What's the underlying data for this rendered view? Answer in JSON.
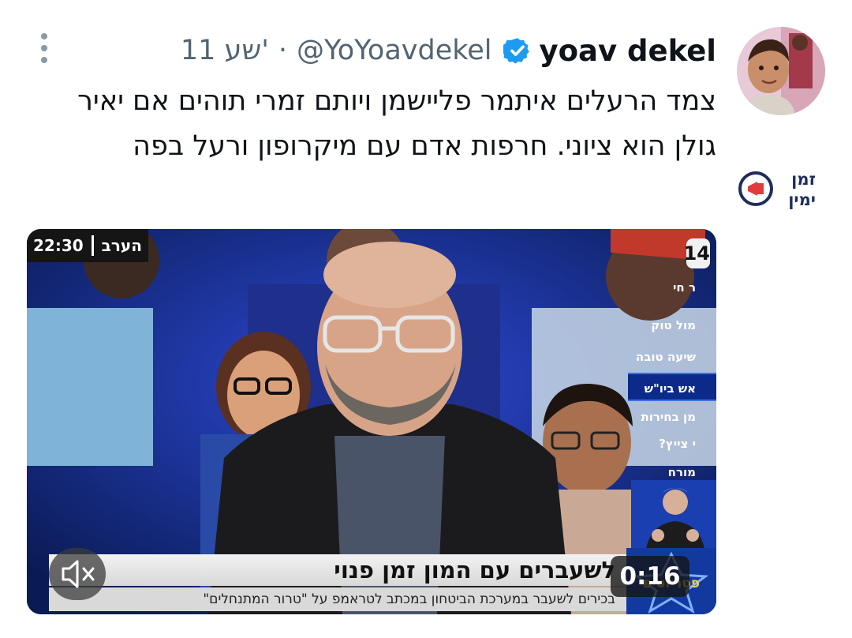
{
  "tweet": {
    "author_name": "yoav dekel",
    "handle": "@YoYoavdekel",
    "separator": "·",
    "time": "11 שע'",
    "text": "צמד הרעלים איתמר פליישמן ויותם זמרי תוהים אם יאיר גולן הוא ציוני. חרפות אדם עם מיקרופון ורעל בפה",
    "verified": true
  },
  "sidebar": {
    "channel_logo_text": [
      "זמן",
      "ימין"
    ]
  },
  "video": {
    "duration": "0:16",
    "muted": true,
    "broadcast": {
      "clock_label": "הערב",
      "clock_time": "22:30",
      "channel_badge": "14",
      "menu_items": [
        "ר חי",
        "מול טוק",
        "שיעה טובה",
        "אש ביו\"ש",
        "מן בחירות",
        "י צייץ?",
        "מורח"
      ],
      "active_menu_index": 3,
      "headline": "לשעברים עם המון זמן פנוי",
      "subline": "בכירים לשעבר במערכת הביטחון במכתב לטראמפ על \"טרור המתנחלים\"",
      "show_logo_text": "פטריוטים"
    }
  },
  "colors": {
    "verified_blue": "#1d9bf0",
    "muted_text": "#536471",
    "studio_blue": "#0a1a52"
  }
}
